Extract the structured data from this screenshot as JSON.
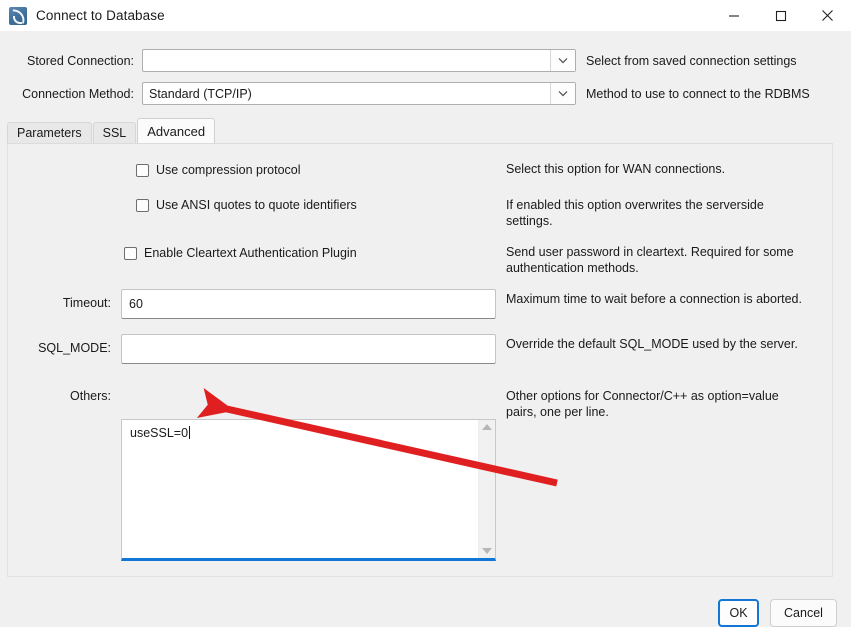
{
  "window": {
    "title": "Connect to Database",
    "icon": "mysql-workbench-dolphin-icon",
    "controls": {
      "minimize": "minimize-icon",
      "maximize": "maximize-icon",
      "close": "close-icon"
    }
  },
  "top": {
    "stored_connection": {
      "label": "Stored Connection:",
      "value": "",
      "hint": "Select from saved connection settings"
    },
    "connection_method": {
      "label": "Connection Method:",
      "value": "Standard (TCP/IP)",
      "hint": "Method to use to connect to the RDBMS"
    }
  },
  "tabs": [
    {
      "label": "Parameters",
      "active": false
    },
    {
      "label": "SSL",
      "active": false
    },
    {
      "label": "Advanced",
      "active": true
    }
  ],
  "advanced": {
    "checkboxes": [
      {
        "label": "Use compression protocol",
        "checked": false,
        "desc": "Select this option for WAN connections."
      },
      {
        "label": "Use ANSI quotes to quote identifiers",
        "checked": false,
        "desc": "If enabled this option overwrites the serverside settings."
      },
      {
        "label": "Enable Cleartext Authentication Plugin",
        "checked": false,
        "desc": "Send user password in cleartext. Required for some authentication methods."
      }
    ],
    "fields": [
      {
        "label": "Timeout:",
        "value": "60",
        "desc": "Maximum time to wait before a connection is aborted."
      },
      {
        "label": "SQL_MODE:",
        "value": "",
        "desc": "Override the default SQL_MODE used by the server."
      }
    ],
    "others": {
      "label": "Others:",
      "value": "useSSL=0",
      "desc": "Other options for Connector/C++ as option=value pairs, one per line.",
      "scroll_up": "scroll-up-arrow-icon",
      "scroll_down": "scroll-down-arrow-icon"
    }
  },
  "buttons": {
    "ok": "OK",
    "cancel": "Cancel"
  },
  "annotation": {
    "color": "#e02020",
    "type": "arrow",
    "points_to": "others-textarea-value"
  },
  "colors": {
    "dialog_bg": "#f0f0f0",
    "accent": "#1277d4",
    "annotation_red": "#e02020"
  }
}
